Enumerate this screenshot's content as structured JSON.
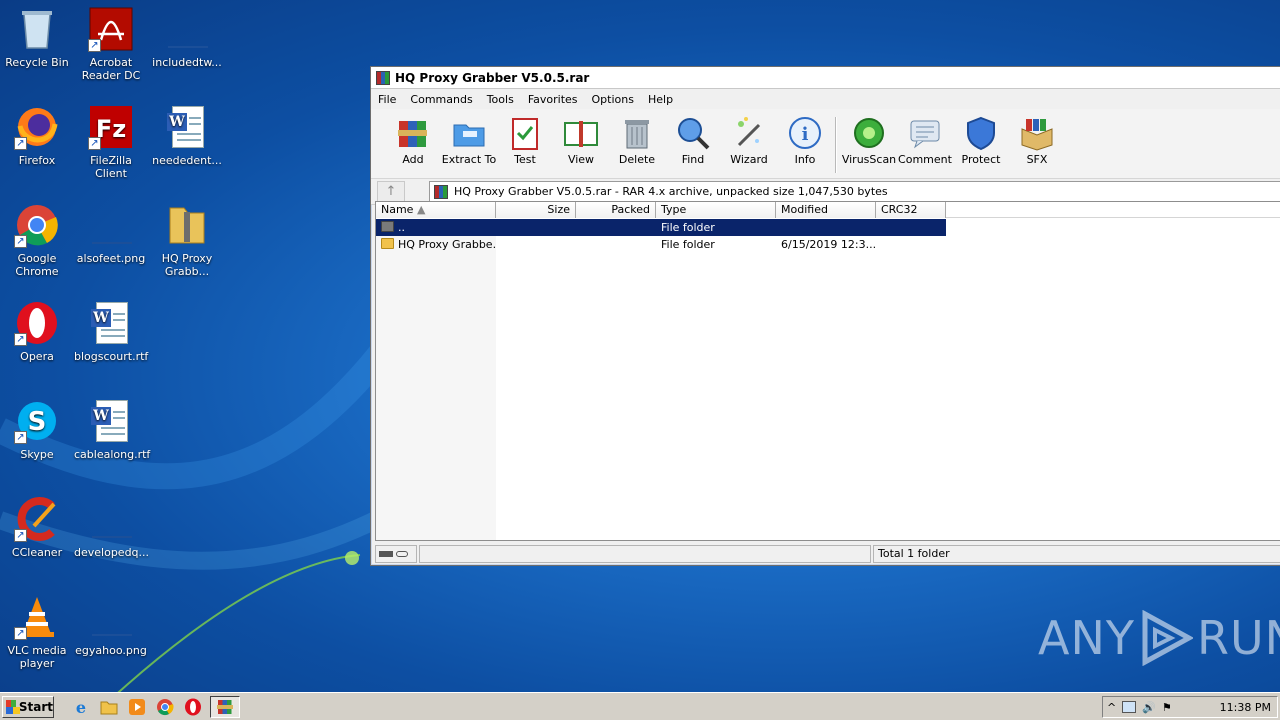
{
  "desktop": {
    "icons": [
      {
        "label": "Recycle Bin"
      },
      {
        "label": "Acrobat Reader DC"
      },
      {
        "label": "includedtw..."
      },
      {
        "label": "Firefox"
      },
      {
        "label": "FileZilla Client"
      },
      {
        "label": "neededent..."
      },
      {
        "label": "Google Chrome"
      },
      {
        "label": "alsofeet.png"
      },
      {
        "label": "HQ Proxy Grabb..."
      },
      {
        "label": "Opera"
      },
      {
        "label": "blogscourt.rtf"
      },
      {
        "label": "Skype"
      },
      {
        "label": "cablealong.rtf"
      },
      {
        "label": "CCleaner"
      },
      {
        "label": "developedq..."
      },
      {
        "label": "VLC media player"
      },
      {
        "label": "egyahoo.png"
      }
    ]
  },
  "window": {
    "title": "HQ Proxy Grabber V5.0.5.rar",
    "menu": [
      "File",
      "Commands",
      "Tools",
      "Favorites",
      "Options",
      "Help"
    ],
    "toolbar": [
      {
        "label": "Add",
        "icon": "add-archive-icon"
      },
      {
        "label": "Extract To",
        "icon": "extract-folder-icon"
      },
      {
        "label": "Test",
        "icon": "test-clipboard-icon"
      },
      {
        "label": "View",
        "icon": "view-book-icon"
      },
      {
        "label": "Delete",
        "icon": "trash-can-icon"
      },
      {
        "label": "Find",
        "icon": "magnifier-icon"
      },
      {
        "label": "Wizard",
        "icon": "magic-wand-icon"
      },
      {
        "label": "Info",
        "icon": "info-icon"
      },
      {
        "label": "VirusScan",
        "icon": "virus-bug-icon"
      },
      {
        "label": "Comment",
        "icon": "comment-icon"
      },
      {
        "label": "Protect",
        "icon": "shield-icon"
      },
      {
        "label": "SFX",
        "icon": "sfx-box-icon"
      }
    ],
    "address": "HQ Proxy Grabber V5.0.5.rar - RAR 4.x archive, unpacked size 1,047,530 bytes",
    "columns": {
      "name": "Name",
      "size": "Size",
      "packed": "Packed",
      "type": "Type",
      "modified": "Modified",
      "crc": "CRC32"
    },
    "rows": [
      {
        "name": "..",
        "size": "",
        "packed": "",
        "type": "File folder",
        "modified": "",
        "crc": ""
      },
      {
        "name": "HQ Proxy Grabbe...",
        "size": "",
        "packed": "",
        "type": "File folder",
        "modified": "6/15/2019 12:3...",
        "crc": ""
      }
    ],
    "status": "Total 1 folder"
  },
  "taskbar": {
    "start": "Start",
    "clock": "11:38 PM"
  },
  "watermark": {
    "left": "ANY",
    "right": "RUN"
  }
}
